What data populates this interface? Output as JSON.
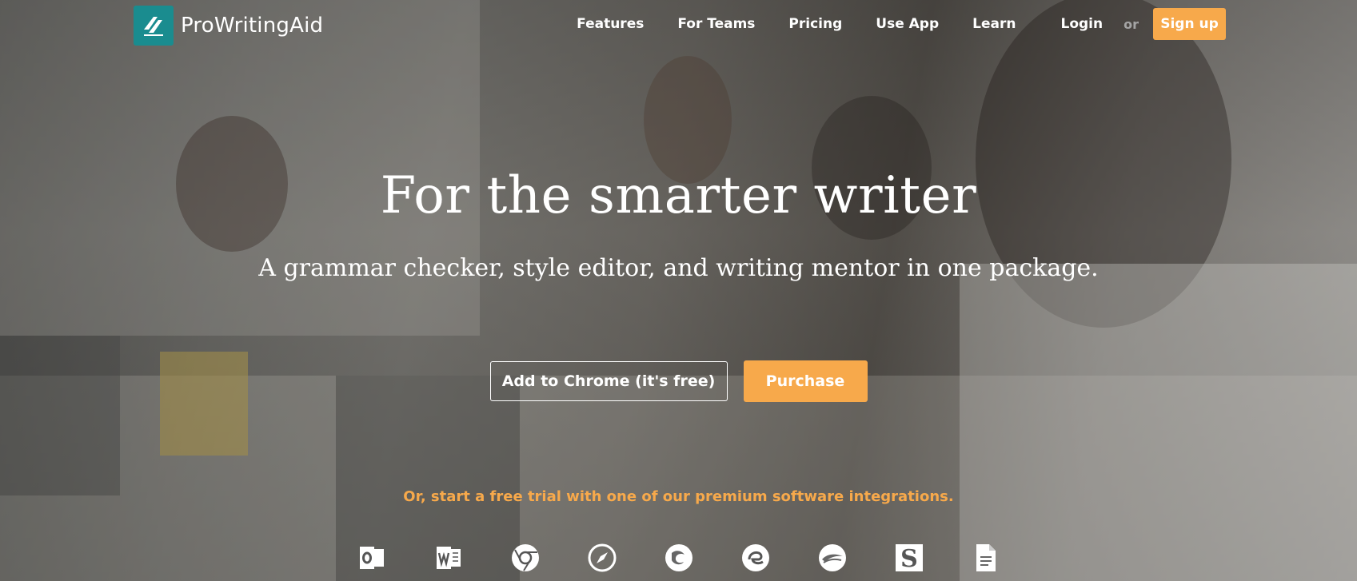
{
  "brand": {
    "name": "ProWritingAid",
    "accent": "#1a8c8f"
  },
  "nav": {
    "items": [
      {
        "label": "Features"
      },
      {
        "label": "For Teams"
      },
      {
        "label": "Pricing"
      },
      {
        "label": "Use App"
      },
      {
        "label": "Learn"
      }
    ],
    "login": "Login",
    "or": "or",
    "signup": "Sign up"
  },
  "hero": {
    "headline": "For the smarter writer",
    "subheadline": "A grammar checker, style editor, and writing mentor in one package.",
    "cta_primary": "Add to Chrome (it's free)",
    "cta_secondary": "Purchase",
    "trial_text": "Or, start a free trial with one of our premium software integrations."
  },
  "integrations": [
    {
      "icon": "outlook-icon"
    },
    {
      "icon": "word-icon"
    },
    {
      "icon": "chrome-icon"
    },
    {
      "icon": "safari-icon"
    },
    {
      "icon": "firefox-icon"
    },
    {
      "icon": "edge-icon"
    },
    {
      "icon": "openoffice-icon"
    },
    {
      "icon": "scrivener-icon"
    },
    {
      "icon": "google-docs-icon"
    }
  ],
  "colors": {
    "orange": "#f7a94b",
    "teal": "#1a8c8f",
    "muted": "#a4a4a4"
  }
}
